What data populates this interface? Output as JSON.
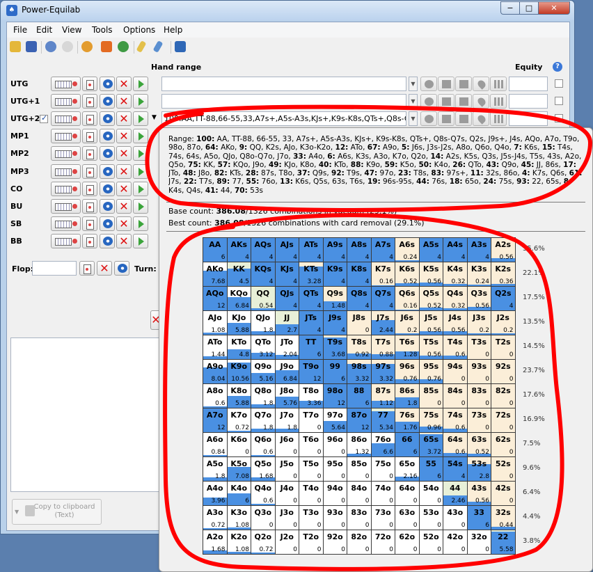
{
  "window": {
    "title": "Power-Equilab",
    "icon": "spade-app-icon",
    "controls": {
      "minimize": "−",
      "maximize": "□",
      "close": "✕"
    }
  },
  "menu": [
    "File",
    "Edit",
    "View",
    "Tools",
    "Options",
    "Help"
  ],
  "toolbar": {
    "icons": [
      "open-folder-icon",
      "save-icon",
      "undo-icon",
      "redo-icon",
      "settings-gear-icon",
      "fire-icon",
      "refresh-globe-icon",
      "pencil-icon",
      "edit-pen-icon",
      "eraser-icon"
    ]
  },
  "headers": {
    "hand_range": "Hand range",
    "equity": "Equity",
    "help": "?"
  },
  "positions": [
    {
      "label": "UTG",
      "range": "",
      "checked": false
    },
    {
      "label": "UTG+1",
      "range": "",
      "checked": false
    },
    {
      "label": "UTG+2",
      "range": "100:AA,TT-88,66-55,33,A7s+,A5s-A3s,KJs+,K9s-K8s,QTs+,Q8s-Q7s,Q",
      "checked": true
    },
    {
      "label": "MP1"
    },
    {
      "label": "MP2"
    },
    {
      "label": "MP3"
    },
    {
      "label": "CO"
    },
    {
      "label": "BU"
    },
    {
      "label": "SB"
    },
    {
      "label": "BB"
    }
  ],
  "board": {
    "flop_label": "Flop:",
    "turn_label": "Turn:"
  },
  "copy_button": {
    "label": "Copy to clipboard",
    "sub": "(Text)"
  },
  "popup": {
    "range": [
      {
        "b": "",
        "t": "Range: "
      },
      {
        "b": "100:",
        "t": " AA, TT-88, 66-55, 33, A7s+, A5s-A3s, KJs+, K9s-K8s, QTs+, Q8s-Q7s, Q2s, J9s+, J4s, AQo, A7o, T9o, 98o, 87o, "
      },
      {
        "b": "64:",
        "t": " AKo, "
      },
      {
        "b": "9:",
        "t": " QQ, K2s, AJo, K3o-K2o, "
      },
      {
        "b": "12:",
        "t": " ATo, "
      },
      {
        "b": "67:",
        "t": " A9o, "
      },
      {
        "b": "5:",
        "t": " J6s, J3s-J2s, A8o, Q6o, Q4o, "
      },
      {
        "b": "7:",
        "t": " K6s, "
      },
      {
        "b": "15:",
        "t": " T4s, 74s, 64s, A5o, QJo, Q8o-Q7o, J7o, "
      },
      {
        "b": "33:",
        "t": " A4o, "
      },
      {
        "b": "6:",
        "t": " A6s, K3s, A3o, K7o, Q2o, "
      },
      {
        "b": "14:",
        "t": " A2s, K5s, Q3s, J5s-J4s, T5s, 43s, A2o, Q5o, "
      },
      {
        "b": "75:",
        "t": " KK, "
      },
      {
        "b": "57:",
        "t": " KQo, J9o, "
      },
      {
        "b": "49:",
        "t": " KJo, K8o, "
      },
      {
        "b": "40:",
        "t": " KTo, "
      },
      {
        "b": "88:",
        "t": " K9o, "
      },
      {
        "b": "59:",
        "t": " K5o, "
      },
      {
        "b": "50:",
        "t": " K4o, "
      },
      {
        "b": "26:",
        "t": " QTo, "
      },
      {
        "b": "43:",
        "t": " Q9o, "
      },
      {
        "b": "45:",
        "t": " JJ, 86s, "
      },
      {
        "b": "17:",
        "t": " JTo, "
      },
      {
        "b": "48:",
        "t": " J8o, "
      },
      {
        "b": "82:",
        "t": " KTs, "
      },
      {
        "b": "28:",
        "t": " 87s, T8o, "
      },
      {
        "b": "37:",
        "t": " Q9s, "
      },
      {
        "b": "92:",
        "t": " T9s, "
      },
      {
        "b": "47:",
        "t": " 97o, "
      },
      {
        "b": "23:",
        "t": " T8s, "
      },
      {
        "b": "83:",
        "t": " 97s+, "
      },
      {
        "b": "11:",
        "t": " 32s, 86o, "
      },
      {
        "b": "4:",
        "t": " K7s, Q6s, "
      },
      {
        "b": "61:",
        "t": " J7s, "
      },
      {
        "b": "22:",
        "t": " T7s, "
      },
      {
        "b": "89:",
        "t": " 77, "
      },
      {
        "b": "55:",
        "t": " 76o, "
      },
      {
        "b": "13:",
        "t": " K6s, Q5s, 63s, T6s, "
      },
      {
        "b": "19:",
        "t": " 96s-95s, "
      },
      {
        "b": "44:",
        "t": " 76s, "
      },
      {
        "b": "18:",
        "t": " 65o, "
      },
      {
        "b": "24:",
        "t": " 75s, "
      },
      {
        "b": "93:",
        "t": " 22, 65s, "
      },
      {
        "b": "8:",
        "t": " K4s, Q4s, "
      },
      {
        "b": "41:",
        "t": " 44, "
      },
      {
        "b": "70:",
        "t": " 53s"
      }
    ],
    "base_count": {
      "label": "Base count: ",
      "value": "386.08",
      "rest": "/1326 combinations in vacuum (29.1%)"
    },
    "best_count": {
      "label": "Best count: ",
      "value": "386.08",
      "rest": "/1326 combinations with card removal (29.1%)"
    }
  },
  "grid": {
    "ranks": [
      "A",
      "K",
      "Q",
      "J",
      "T",
      "9",
      "8",
      "7",
      "6",
      "5",
      "4",
      "3",
      "2"
    ],
    "cells": [
      [
        {
          "h": "AA",
          "v": "6",
          "f": 1
        },
        {
          "h": "AKs",
          "v": "4",
          "f": 1
        },
        {
          "h": "AQs",
          "v": "4",
          "f": 1
        },
        {
          "h": "AJs",
          "v": "4",
          "f": 1
        },
        {
          "h": "ATs",
          "v": "4",
          "f": 1
        },
        {
          "h": "A9s",
          "v": "4",
          "f": 1
        },
        {
          "h": "A8s",
          "v": "4",
          "f": 1
        },
        {
          "h": "A7s",
          "v": "4",
          "f": 1
        },
        {
          "h": "A6s",
          "v": "0.24",
          "f": 0.06
        },
        {
          "h": "A5s",
          "v": "4",
          "f": 1
        },
        {
          "h": "A4s",
          "v": "4",
          "f": 1
        },
        {
          "h": "A3s",
          "v": "4",
          "f": 1
        },
        {
          "h": "A2s",
          "v": "0.56",
          "f": 0.14
        }
      ],
      [
        {
          "h": "AKo",
          "v": "7.68",
          "f": 0.64
        },
        {
          "h": "KK",
          "v": "4.5",
          "f": 0.75
        },
        {
          "h": "KQs",
          "v": "4",
          "f": 1
        },
        {
          "h": "KJs",
          "v": "4",
          "f": 1
        },
        {
          "h": "KTs",
          "v": "3.28",
          "f": 0.82
        },
        {
          "h": "K9s",
          "v": "4",
          "f": 1
        },
        {
          "h": "K8s",
          "v": "4",
          "f": 1
        },
        {
          "h": "K7s",
          "v": "0.16",
          "f": 0.04
        },
        {
          "h": "K6s",
          "v": "0.52",
          "f": 0.13
        },
        {
          "h": "K5s",
          "v": "0.56",
          "f": 0.14
        },
        {
          "h": "K4s",
          "v": "0.32",
          "f": 0.08
        },
        {
          "h": "K3s",
          "v": "0.24",
          "f": 0.06
        },
        {
          "h": "K2s",
          "v": "0.36",
          "f": 0.09
        }
      ],
      [
        {
          "h": "AQo",
          "v": "12",
          "f": 1
        },
        {
          "h": "KQo",
          "v": "6.84",
          "f": 0.57
        },
        {
          "h": "QQ",
          "v": "0.54",
          "f": 0.09
        },
        {
          "h": "QJs",
          "v": "4",
          "f": 1
        },
        {
          "h": "QTs",
          "v": "4",
          "f": 1
        },
        {
          "h": "Q9s",
          "v": "1.48",
          "f": 0.37
        },
        {
          "h": "Q8s",
          "v": "4",
          "f": 1
        },
        {
          "h": "Q7s",
          "v": "4",
          "f": 1
        },
        {
          "h": "Q6s",
          "v": "0.16",
          "f": 0.04
        },
        {
          "h": "Q5s",
          "v": "0.52",
          "f": 0.13
        },
        {
          "h": "Q4s",
          "v": "0.32",
          "f": 0.08
        },
        {
          "h": "Q3s",
          "v": "0.56",
          "f": 0.14
        },
        {
          "h": "Q2s",
          "v": "4",
          "f": 1
        }
      ],
      [
        {
          "h": "AJo",
          "v": "1.08",
          "f": 0.09
        },
        {
          "h": "KJo",
          "v": "5.88",
          "f": 0.49
        },
        {
          "h": "QJo",
          "v": "1.8",
          "f": 0.15
        },
        {
          "h": "JJ",
          "v": "2.7",
          "f": 0.45
        },
        {
          "h": "JTs",
          "v": "4",
          "f": 1
        },
        {
          "h": "J9s",
          "v": "4",
          "f": 1
        },
        {
          "h": "J8s",
          "v": "0",
          "f": 0
        },
        {
          "h": "J7s",
          "v": "2.44",
          "f": 0.61
        },
        {
          "h": "J6s",
          "v": "0.2",
          "f": 0.05
        },
        {
          "h": "J5s",
          "v": "0.56",
          "f": 0.14
        },
        {
          "h": "J4s",
          "v": "0.56",
          "f": 0.14
        },
        {
          "h": "J3s",
          "v": "0.2",
          "f": 0.05
        },
        {
          "h": "J2s",
          "v": "0.2",
          "f": 0.05
        }
      ],
      [
        {
          "h": "ATo",
          "v": "1.44",
          "f": 0.12
        },
        {
          "h": "KTo",
          "v": "4.8",
          "f": 0.4
        },
        {
          "h": "QTo",
          "v": "3.12",
          "f": 0.26
        },
        {
          "h": "JTo",
          "v": "2.04",
          "f": 0.17
        },
        {
          "h": "TT",
          "v": "6",
          "f": 1
        },
        {
          "h": "T9s",
          "v": "3.68",
          "f": 0.92
        },
        {
          "h": "T8s",
          "v": "0.92",
          "f": 0.23
        },
        {
          "h": "T7s",
          "v": "0.88",
          "f": 0.22
        },
        {
          "h": "T6s",
          "v": "1.28",
          "f": 0.32
        },
        {
          "h": "T5s",
          "v": "0.56",
          "f": 0.14
        },
        {
          "h": "T4s",
          "v": "0.6",
          "f": 0.15
        },
        {
          "h": "T3s",
          "v": "0",
          "f": 0
        },
        {
          "h": "T2s",
          "v": "0",
          "f": 0
        }
      ],
      [
        {
          "h": "A9o",
          "v": "8.04",
          "f": 0.67
        },
        {
          "h": "K9o",
          "v": "10.56",
          "f": 0.88
        },
        {
          "h": "Q9o",
          "v": "5.16",
          "f": 0.43
        },
        {
          "h": "J9o",
          "v": "6.84",
          "f": 0.57
        },
        {
          "h": "T9o",
          "v": "12",
          "f": 1
        },
        {
          "h": "99",
          "v": "6",
          "f": 1
        },
        {
          "h": "98s",
          "v": "3.32",
          "f": 0.83
        },
        {
          "h": "97s",
          "v": "3.32",
          "f": 0.83
        },
        {
          "h": "96s",
          "v": "0.76",
          "f": 0.19
        },
        {
          "h": "95s",
          "v": "0.76",
          "f": 0.19
        },
        {
          "h": "94s",
          "v": "0",
          "f": 0
        },
        {
          "h": "93s",
          "v": "0",
          "f": 0
        },
        {
          "h": "92s",
          "v": "0",
          "f": 0
        }
      ],
      [
        {
          "h": "A8o",
          "v": "0.6",
          "f": 0.05
        },
        {
          "h": "K8o",
          "v": "5.88",
          "f": 0.49
        },
        {
          "h": "Q8o",
          "v": "1.8",
          "f": 0.15
        },
        {
          "h": "J8o",
          "v": "5.76",
          "f": 0.48
        },
        {
          "h": "T8o",
          "v": "3.36",
          "f": 0.28
        },
        {
          "h": "98o",
          "v": "12",
          "f": 1
        },
        {
          "h": "88",
          "v": "6",
          "f": 1
        },
        {
          "h": "87s",
          "v": "1.12",
          "f": 0.28
        },
        {
          "h": "86s",
          "v": "1.8",
          "f": 0.45
        },
        {
          "h": "85s",
          "v": "0",
          "f": 0
        },
        {
          "h": "84s",
          "v": "0",
          "f": 0
        },
        {
          "h": "83s",
          "v": "0",
          "f": 0
        },
        {
          "h": "82s",
          "v": "0",
          "f": 0
        }
      ],
      [
        {
          "h": "A7o",
          "v": "12",
          "f": 1
        },
        {
          "h": "K7o",
          "v": "0.72",
          "f": 0.06
        },
        {
          "h": "Q7o",
          "v": "1.8",
          "f": 0.15
        },
        {
          "h": "J7o",
          "v": "1.8",
          "f": 0.15
        },
        {
          "h": "T7o",
          "v": "0",
          "f": 0
        },
        {
          "h": "97o",
          "v": "5.64",
          "f": 0.47
        },
        {
          "h": "87o",
          "v": "12",
          "f": 1
        },
        {
          "h": "77",
          "v": "5.34",
          "f": 0.89
        },
        {
          "h": "76s",
          "v": "1.76",
          "f": 0.44
        },
        {
          "h": "75s",
          "v": "0.96",
          "f": 0.24
        },
        {
          "h": "74s",
          "v": "0.6",
          "f": 0.15
        },
        {
          "h": "73s",
          "v": "0",
          "f": 0
        },
        {
          "h": "72s",
          "v": "0",
          "f": 0
        }
      ],
      [
        {
          "h": "A6o",
          "v": "0.84",
          "f": 0.07
        },
        {
          "h": "K6o",
          "v": "0",
          "f": 0
        },
        {
          "h": "Q6o",
          "v": "0.6",
          "f": 0.05
        },
        {
          "h": "J6o",
          "v": "0",
          "f": 0
        },
        {
          "h": "T6o",
          "v": "0",
          "f": 0
        },
        {
          "h": "96o",
          "v": "0",
          "f": 0
        },
        {
          "h": "86o",
          "v": "1.32",
          "f": 0.11
        },
        {
          "h": "76o",
          "v": "6.6",
          "f": 0.55
        },
        {
          "h": "66",
          "v": "6",
          "f": 1
        },
        {
          "h": "65s",
          "v": "3.72",
          "f": 0.93
        },
        {
          "h": "64s",
          "v": "0.6",
          "f": 0.15
        },
        {
          "h": "63s",
          "v": "0.52",
          "f": 0.13
        },
        {
          "h": "62s",
          "v": "0",
          "f": 0
        }
      ],
      [
        {
          "h": "A5o",
          "v": "1.8",
          "f": 0.15
        },
        {
          "h": "K5o",
          "v": "7.08",
          "f": 0.59
        },
        {
          "h": "Q5o",
          "v": "1.68",
          "f": 0.14
        },
        {
          "h": "J5o",
          "v": "0",
          "f": 0
        },
        {
          "h": "T5o",
          "v": "0",
          "f": 0
        },
        {
          "h": "95o",
          "v": "0",
          "f": 0
        },
        {
          "h": "85o",
          "v": "0",
          "f": 0
        },
        {
          "h": "75o",
          "v": "0",
          "f": 0
        },
        {
          "h": "65o",
          "v": "2.16",
          "f": 0.18
        },
        {
          "h": "55",
          "v": "6",
          "f": 1
        },
        {
          "h": "54s",
          "v": "4",
          "f": 1
        },
        {
          "h": "53s",
          "v": "2.8",
          "f": 0.7
        },
        {
          "h": "52s",
          "v": "0",
          "f": 0
        }
      ],
      [
        {
          "h": "A4o",
          "v": "3.96",
          "f": 0.33
        },
        {
          "h": "K4o",
          "v": "6",
          "f": 0.5
        },
        {
          "h": "Q4o",
          "v": "0.6",
          "f": 0.05
        },
        {
          "h": "J4o",
          "v": "0",
          "f": 0
        },
        {
          "h": "T4o",
          "v": "0",
          "f": 0
        },
        {
          "h": "94o",
          "v": "0",
          "f": 0
        },
        {
          "h": "84o",
          "v": "0",
          "f": 0
        },
        {
          "h": "74o",
          "v": "0",
          "f": 0
        },
        {
          "h": "64o",
          "v": "0",
          "f": 0
        },
        {
          "h": "54o",
          "v": "0",
          "f": 0
        },
        {
          "h": "44",
          "v": "2.46",
          "f": 0.41
        },
        {
          "h": "43s",
          "v": "0.56",
          "f": 0.14
        },
        {
          "h": "42s",
          "v": "0",
          "f": 0
        }
      ],
      [
        {
          "h": "A3o",
          "v": "0.72",
          "f": 0.06
        },
        {
          "h": "K3o",
          "v": "1.08",
          "f": 0.09
        },
        {
          "h": "Q3o",
          "v": "0",
          "f": 0
        },
        {
          "h": "J3o",
          "v": "0",
          "f": 0
        },
        {
          "h": "T3o",
          "v": "0",
          "f": 0
        },
        {
          "h": "93o",
          "v": "0",
          "f": 0
        },
        {
          "h": "83o",
          "v": "0",
          "f": 0
        },
        {
          "h": "73o",
          "v": "0",
          "f": 0
        },
        {
          "h": "63o",
          "v": "0",
          "f": 0
        },
        {
          "h": "53o",
          "v": "0",
          "f": 0
        },
        {
          "h": "43o",
          "v": "0",
          "f": 0
        },
        {
          "h": "33",
          "v": "6",
          "f": 1
        },
        {
          "h": "32s",
          "v": "0.44",
          "f": 0.11
        }
      ],
      [
        {
          "h": "A2o",
          "v": "1.68",
          "f": 0.14
        },
        {
          "h": "K2o",
          "v": "1.08",
          "f": 0.09
        },
        {
          "h": "Q2o",
          "v": "0.72",
          "f": 0.06
        },
        {
          "h": "J2o",
          "v": "0",
          "f": 0
        },
        {
          "h": "T2o",
          "v": "0",
          "f": 0
        },
        {
          "h": "92o",
          "v": "0",
          "f": 0
        },
        {
          "h": "82o",
          "v": "0",
          "f": 0
        },
        {
          "h": "72o",
          "v": "0",
          "f": 0
        },
        {
          "h": "62o",
          "v": "0",
          "f": 0
        },
        {
          "h": "52o",
          "v": "0",
          "f": 0
        },
        {
          "h": "42o",
          "v": "0",
          "f": 0
        },
        {
          "h": "32o",
          "v": "0",
          "f": 0
        },
        {
          "h": "22",
          "v": "5.58",
          "f": 0.93
        }
      ]
    ],
    "row_pct": [
      "35.6%",
      "22.1%",
      "17.5%",
      "13.5%",
      "14.5%",
      "23.7%",
      "17.6%",
      "16.9%",
      "7.5%",
      "9.6%",
      "6.4%",
      "4.4%",
      "3.8%"
    ],
    "colors": {
      "selected": "#4a90e2",
      "pair": "#e8f0d8",
      "suited": "#fbeed8",
      "offsuit": "#ffffff"
    }
  },
  "annotation": {
    "color": "#ff0000"
  }
}
